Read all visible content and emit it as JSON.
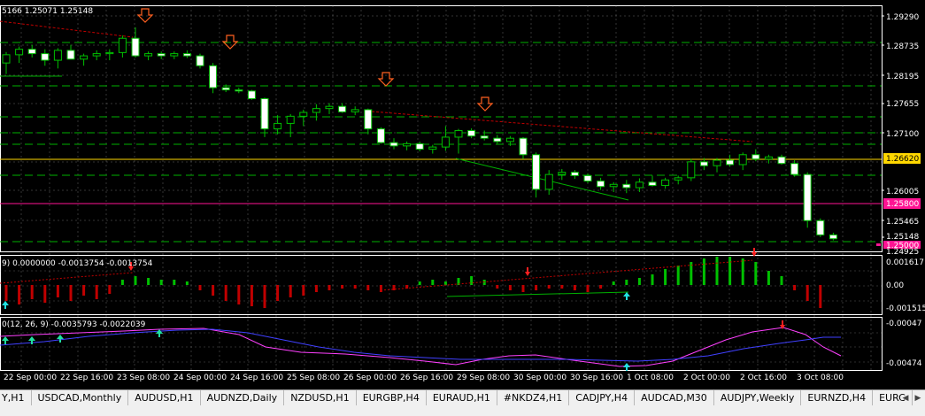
{
  "colors": {
    "background": "#000000",
    "grid": "#c0c0c0",
    "axis": "#ffffff",
    "candle_up": "#00c000",
    "candle_down": "#ffffff",
    "fractal_arrow": "#ff6020",
    "resistance_line": "#ffd700",
    "support_line": "#ff1493",
    "level_lines": "#00b000",
    "histogram_up": "#00c000",
    "histogram_down": "#c00000",
    "macd_main": "#ff40ff",
    "macd_signal": "#4040ff"
  },
  "main_panel": {
    "label": "5166 1.25071 1.25148",
    "price_ticks": [
      "1.29290",
      "1.28735",
      "1.28195",
      "1.27655",
      "1.27100",
      "1.26600",
      "1.26005",
      "1.25465"
    ],
    "resistance_label": "1.26620",
    "support_label": "1.25800",
    "current_price_label": "1.25148",
    "bid_label": "1.25000",
    "bottom_tick": "1.24925"
  },
  "osc_panel": {
    "label": "9) 0.0000000 -0.0013754 -0.0013754",
    "ticks": [
      "0.0016171",
      "0.00",
      "-0.0015157"
    ]
  },
  "macd_panel": {
    "label": "0(12, 26, 9) -0.0035793 -0.0022039",
    "ticks": [
      "-0.00047",
      "-0.00474"
    ]
  },
  "time_axis": [
    "22 Sep 00:00",
    "22 Sep 16:00",
    "23 Sep 08:00",
    "24 Sep 00:00",
    "24 Sep 16:00",
    "25 Sep 08:00",
    "26 Sep 00:00",
    "26 Sep 16:00",
    "29 Sep 08:00",
    "30 Sep 00:00",
    "30 Sep 16:00",
    "1 Oct 08:00",
    "2 Oct 00:00",
    "2 Oct 16:00",
    "3 Oct 08:00"
  ],
  "symbol_tabs": [
    "Y,H1",
    "USDCAD,Monthly",
    "AUDUSD,H1",
    "AUDNZD,Daily",
    "NZDUSD,H1",
    "EURGBP,H4",
    "EURAUD,H1",
    "#NKDZ4,H1",
    "CADJPY,H4",
    "AUDCAD,M30",
    "AUDJPY,Weekly",
    "EURNZD,H4",
    "EURC"
  ],
  "chart_data": {
    "type": "candlestick",
    "candles": [
      [
        1.2835,
        1.2855,
        1.2815,
        1.285
      ],
      [
        1.285,
        1.2865,
        1.2835,
        1.286
      ],
      [
        1.286,
        1.2868,
        1.2845,
        1.2852
      ],
      [
        1.2852,
        1.286,
        1.283,
        1.284
      ],
      [
        1.284,
        1.2862,
        1.2825,
        1.2858
      ],
      [
        1.2858,
        1.2868,
        1.2848,
        1.2842
      ],
      [
        1.2842,
        1.2852,
        1.283,
        1.2848
      ],
      [
        1.2848,
        1.2858,
        1.284,
        1.2852
      ],
      [
        1.2852,
        1.286,
        1.284,
        1.2854
      ],
      [
        1.2854,
        1.2885,
        1.2845,
        1.288
      ],
      [
        1.288,
        1.29,
        1.2845,
        1.2848
      ],
      [
        1.2848,
        1.2856,
        1.284,
        1.2852
      ],
      [
        1.2852,
        1.2856,
        1.2842,
        1.2848
      ],
      [
        1.2848,
        1.2856,
        1.2842,
        1.2852
      ],
      [
        1.2852,
        1.2858,
        1.2844,
        1.2848
      ],
      [
        1.2848,
        1.2852,
        1.2825,
        1.283
      ],
      [
        1.283,
        1.2835,
        1.278,
        1.279
      ],
      [
        1.279,
        1.2796,
        1.2782,
        1.2786
      ],
      [
        1.2786,
        1.279,
        1.278,
        1.2784
      ],
      [
        1.2784,
        1.2786,
        1.2768,
        1.277
      ],
      [
        1.277,
        1.2772,
        1.27,
        1.2715
      ],
      [
        1.2715,
        1.274,
        1.2705,
        1.2725
      ],
      [
        1.2725,
        1.2742,
        1.27,
        1.2738
      ],
      [
        1.2738,
        1.275,
        1.272,
        1.2745
      ],
      [
        1.2745,
        1.276,
        1.273,
        1.2752
      ],
      [
        1.2752,
        1.2762,
        1.2742,
        1.2756
      ],
      [
        1.2756,
        1.2762,
        1.2744,
        1.2746
      ],
      [
        1.2746,
        1.2756,
        1.274,
        1.275
      ],
      [
        1.275,
        1.2752,
        1.2705,
        1.2715
      ],
      [
        1.2715,
        1.2718,
        1.2688,
        1.269
      ],
      [
        1.269,
        1.2698,
        1.2678,
        1.2684
      ],
      [
        1.2684,
        1.2692,
        1.2676,
        1.2688
      ],
      [
        1.2688,
        1.2692,
        1.2674,
        1.2678
      ],
      [
        1.2678,
        1.2686,
        1.267,
        1.2682
      ],
      [
        1.2682,
        1.272,
        1.2675,
        1.27
      ],
      [
        1.27,
        1.2715,
        1.267,
        1.2712
      ],
      [
        1.2712,
        1.2716,
        1.2698,
        1.2702
      ],
      [
        1.2702,
        1.2712,
        1.2694,
        1.2698
      ],
      [
        1.2698,
        1.2704,
        1.2688,
        1.2692
      ],
      [
        1.2692,
        1.2702,
        1.2684,
        1.2698
      ],
      [
        1.2698,
        1.27,
        1.266,
        1.2668
      ],
      [
        1.2668,
        1.2672,
        1.259,
        1.2605
      ],
      [
        1.2605,
        1.264,
        1.2595,
        1.2632
      ],
      [
        1.2632,
        1.2642,
        1.2622,
        1.2636
      ],
      [
        1.2636,
        1.264,
        1.2624,
        1.263
      ],
      [
        1.263,
        1.2634,
        1.2616,
        1.262
      ],
      [
        1.262,
        1.2626,
        1.2604,
        1.261
      ],
      [
        1.261,
        1.2618,
        1.26,
        1.2614
      ],
      [
        1.2614,
        1.2622,
        1.2598,
        1.2608
      ],
      [
        1.2608,
        1.2625,
        1.26,
        1.2618
      ],
      [
        1.2618,
        1.263,
        1.261,
        1.2612
      ],
      [
        1.2612,
        1.2626,
        1.2606,
        1.2622
      ],
      [
        1.2622,
        1.263,
        1.2614,
        1.2626
      ],
      [
        1.2626,
        1.266,
        1.262,
        1.2655
      ],
      [
        1.2655,
        1.2662,
        1.264,
        1.2648
      ],
      [
        1.2648,
        1.2662,
        1.2636,
        1.2658
      ],
      [
        1.2658,
        1.2668,
        1.2646,
        1.265
      ],
      [
        1.265,
        1.2672,
        1.264,
        1.2668
      ],
      [
        1.2668,
        1.2678,
        1.2656,
        1.266
      ],
      [
        1.266,
        1.2668,
        1.2652,
        1.2664
      ],
      [
        1.2664,
        1.2668,
        1.265,
        1.2652
      ],
      [
        1.2652,
        1.2658,
        1.2628,
        1.2632
      ],
      [
        1.2632,
        1.2636,
        1.2535,
        1.2548
      ],
      [
        1.2548,
        1.2552,
        1.2518,
        1.2522
      ],
      [
        1.2522,
        1.2526,
        1.2512,
        1.2515
      ]
    ],
    "histogram": [
      -0.0009,
      -0.0011,
      -0.0008,
      -0.001,
      -0.0007,
      -0.0009,
      -0.0006,
      -0.0008,
      -0.0005,
      0.0003,
      0.0005,
      0.0004,
      0.0003,
      0.0003,
      0.0002,
      -0.0003,
      -0.0006,
      -0.0009,
      -0.0011,
      -0.0012,
      -0.0013,
      -0.0009,
      -0.0007,
      -0.0006,
      -0.0004,
      -0.0003,
      -0.0002,
      -0.0002,
      -0.0003,
      -0.0004,
      -0.0003,
      -0.0002,
      0.0002,
      0.0003,
      0.0002,
      0.0004,
      0.0005,
      0.0003,
      -0.0002,
      -0.0003,
      -0.0004,
      -0.0003,
      -0.0002,
      -0.0002,
      -0.0003,
      -0.0004,
      -0.0002,
      0.0002,
      0.0003,
      0.0004,
      0.0006,
      0.0009,
      0.0011,
      0.0013,
      0.0015,
      0.0016,
      0.0016,
      0.0015,
      0.0013,
      0.0008,
      0.0005,
      -0.0003,
      -0.0009,
      -0.0013
    ]
  }
}
